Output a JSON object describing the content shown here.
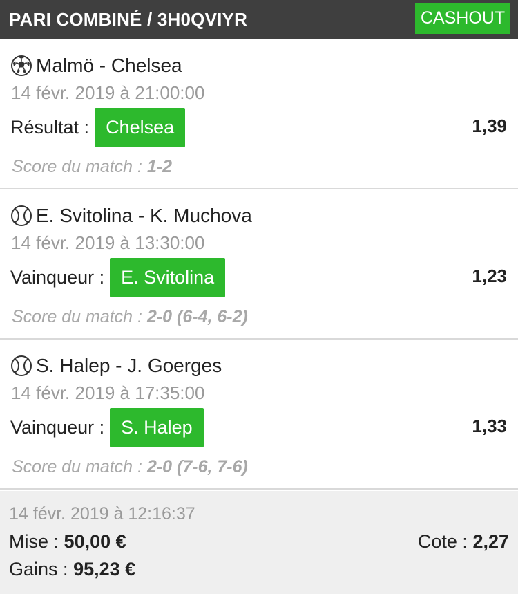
{
  "header": {
    "title": "PARI COMBINÉ / 3H0QVIYR",
    "cashout_label": "CASHOUT",
    "accent_color": "#2db92d"
  },
  "bets": [
    {
      "sport_icon": "soccer-ball-icon",
      "match": "Malmö - Chelsea",
      "date": "14 févr. 2019 à 21:00:00",
      "market_label": "Résultat :",
      "choice": "Chelsea",
      "odds": "1,39",
      "score_label": "Score du match :",
      "score_value": "1-2"
    },
    {
      "sport_icon": "tennis-ball-icon",
      "match": "E. Svitolina - K. Muchova",
      "date": "14 févr. 2019 à 13:30:00",
      "market_label": "Vainqueur :",
      "choice": "E. Svitolina",
      "odds": "1,23",
      "score_label": "Score du match :",
      "score_value": "2-0 (6-4, 6-2)"
    },
    {
      "sport_icon": "tennis-ball-icon",
      "match": "S. Halep - J. Goerges",
      "date": "14 févr. 2019 à 17:35:00",
      "market_label": "Vainqueur :",
      "choice": "S. Halep",
      "odds": "1,33",
      "score_label": "Score du match :",
      "score_value": "2-0 (7-6, 7-6)"
    }
  ],
  "summary": {
    "date": "14 févr. 2019 à 12:16:37",
    "stake_label": "Mise",
    "stake_sep": " :",
    "stake_value": "50,00 €",
    "gains_label": "Gains :",
    "gains_value": "95,23 €",
    "cote_label": "Cote :",
    "cote_value": "2,27"
  }
}
